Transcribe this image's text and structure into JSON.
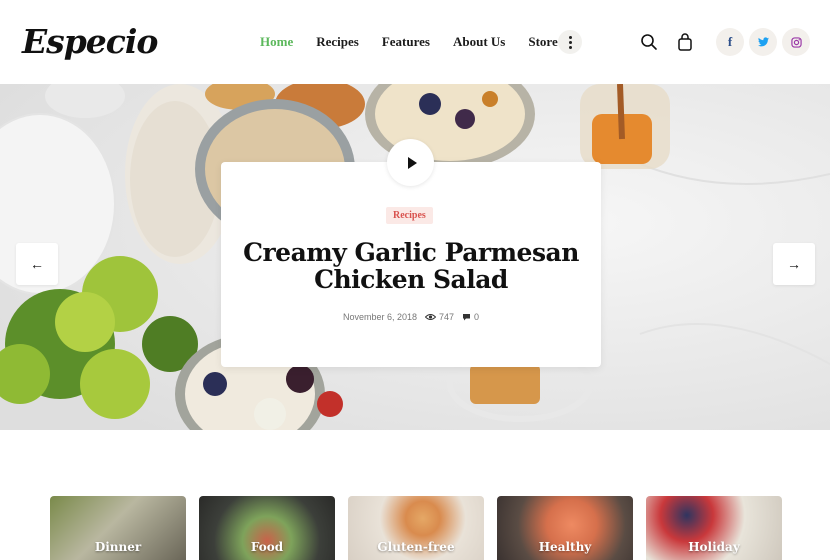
{
  "brand": {
    "logo_text": "Especio"
  },
  "nav": {
    "items": [
      {
        "label": "Home",
        "active": true
      },
      {
        "label": "Recipes",
        "active": false
      },
      {
        "label": "Features",
        "active": false
      },
      {
        "label": "About Us",
        "active": false
      },
      {
        "label": "Store",
        "active": false
      }
    ]
  },
  "header_icons": {
    "more": "more-dots-icon",
    "search": "search-icon",
    "cart": "shopping-bag-icon"
  },
  "social": {
    "facebook": "f",
    "twitter": "twitter-icon",
    "instagram": "instagram-icon"
  },
  "hero": {
    "badge": "Recipes",
    "title_line1": "Creamy Garlic Parmesan",
    "title_line2": "Chicken Salad",
    "date": "November 6, 2018",
    "views": "747",
    "comments": "0",
    "prev_arrow": "←",
    "next_arrow": "→"
  },
  "categories": [
    {
      "label": "Dinner"
    },
    {
      "label": "Food"
    },
    {
      "label": "Gluten-free"
    },
    {
      "label": "Healthy"
    },
    {
      "label": "Holiday"
    }
  ],
  "colors": {
    "accent_green": "#5cb85c",
    "badge_red": "#d9534f",
    "badge_bg": "#fbe9e6"
  }
}
